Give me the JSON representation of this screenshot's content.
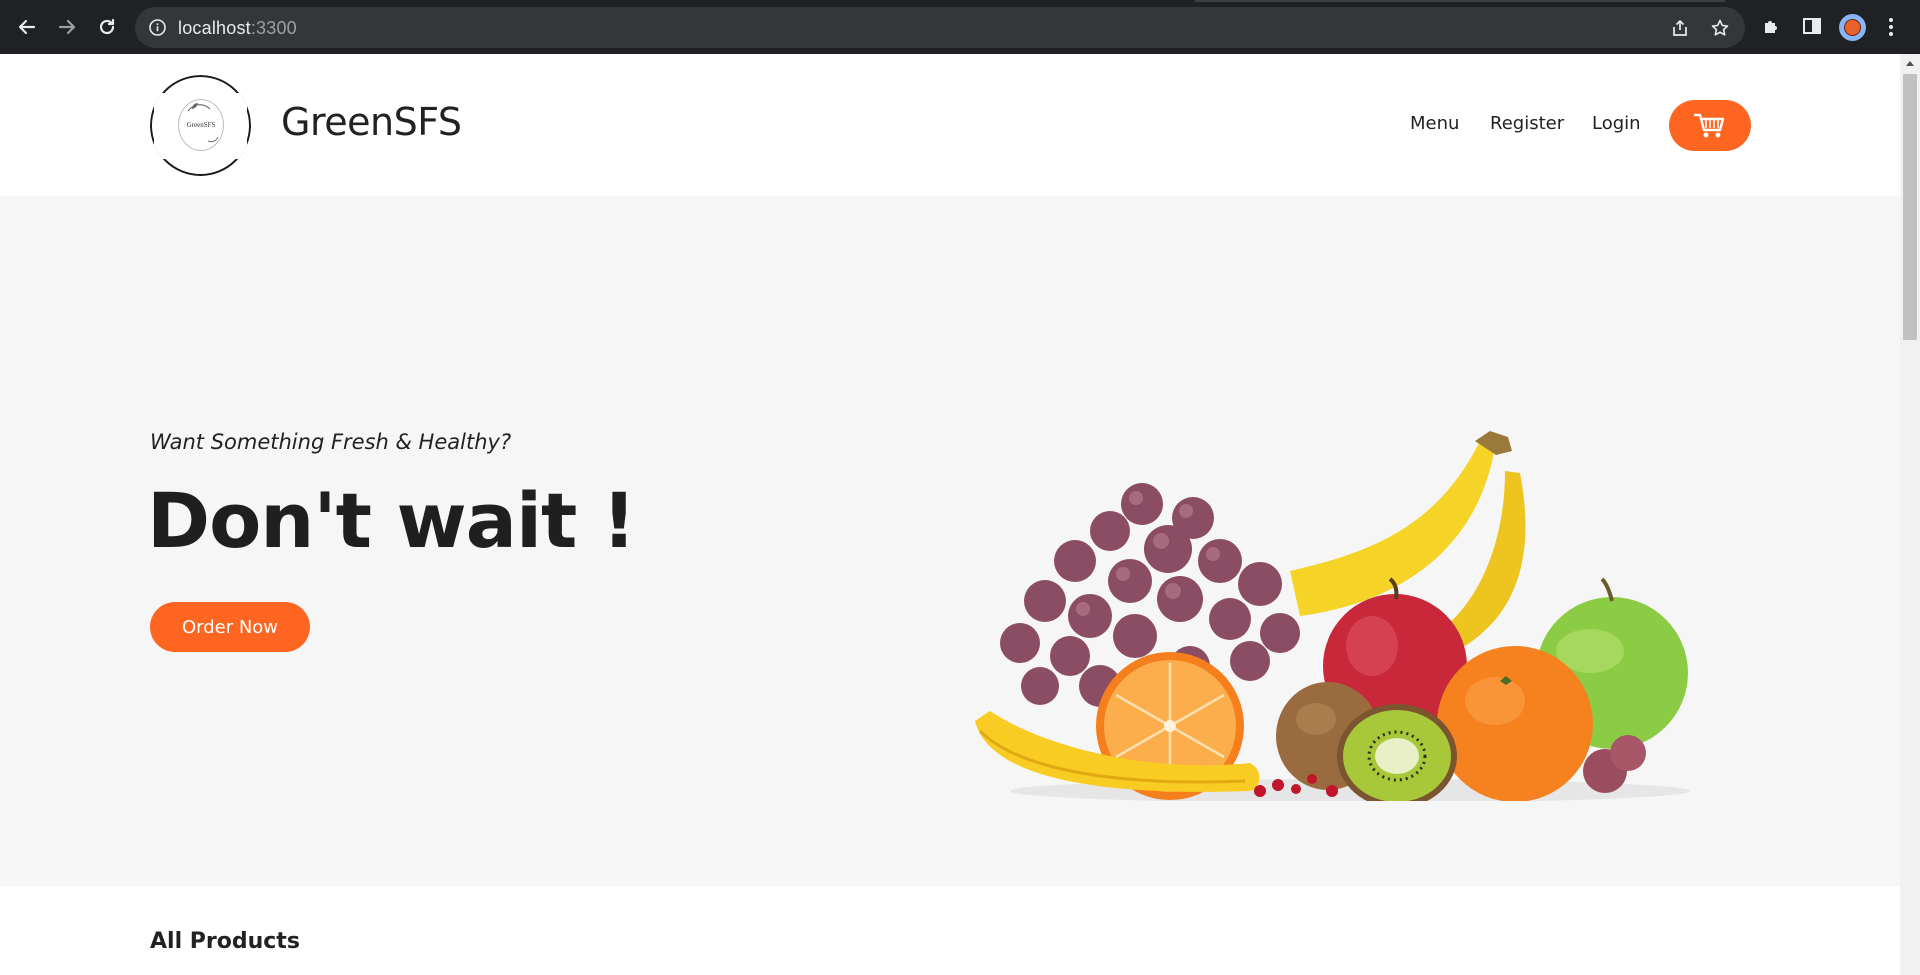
{
  "browser": {
    "url_host": "localhost",
    "url_port": ":3300",
    "icons": [
      "back-icon",
      "forward-icon",
      "reload-icon",
      "info-icon",
      "share-icon",
      "star-icon",
      "extensions-icon",
      "side-panel-icon",
      "profile-avatar",
      "menu-icon"
    ]
  },
  "header": {
    "logo_text": "GreenSFS",
    "brand": "GreenSFS",
    "nav": [
      {
        "label": "Menu"
      },
      {
        "label": "Register"
      },
      {
        "label": "Login"
      }
    ],
    "cart_icon": "cart-icon"
  },
  "hero": {
    "tagline": "Want Something Fresh & Healthy?",
    "title": "Don't wait !",
    "cta": "Order Now",
    "image": "fruit-assortment-image"
  },
  "products": {
    "title": "All Products"
  },
  "colors": {
    "accent": "#fd6520",
    "chrome_bg": "#202124",
    "hero_bg": "#f6f6f6",
    "text": "#222222"
  }
}
